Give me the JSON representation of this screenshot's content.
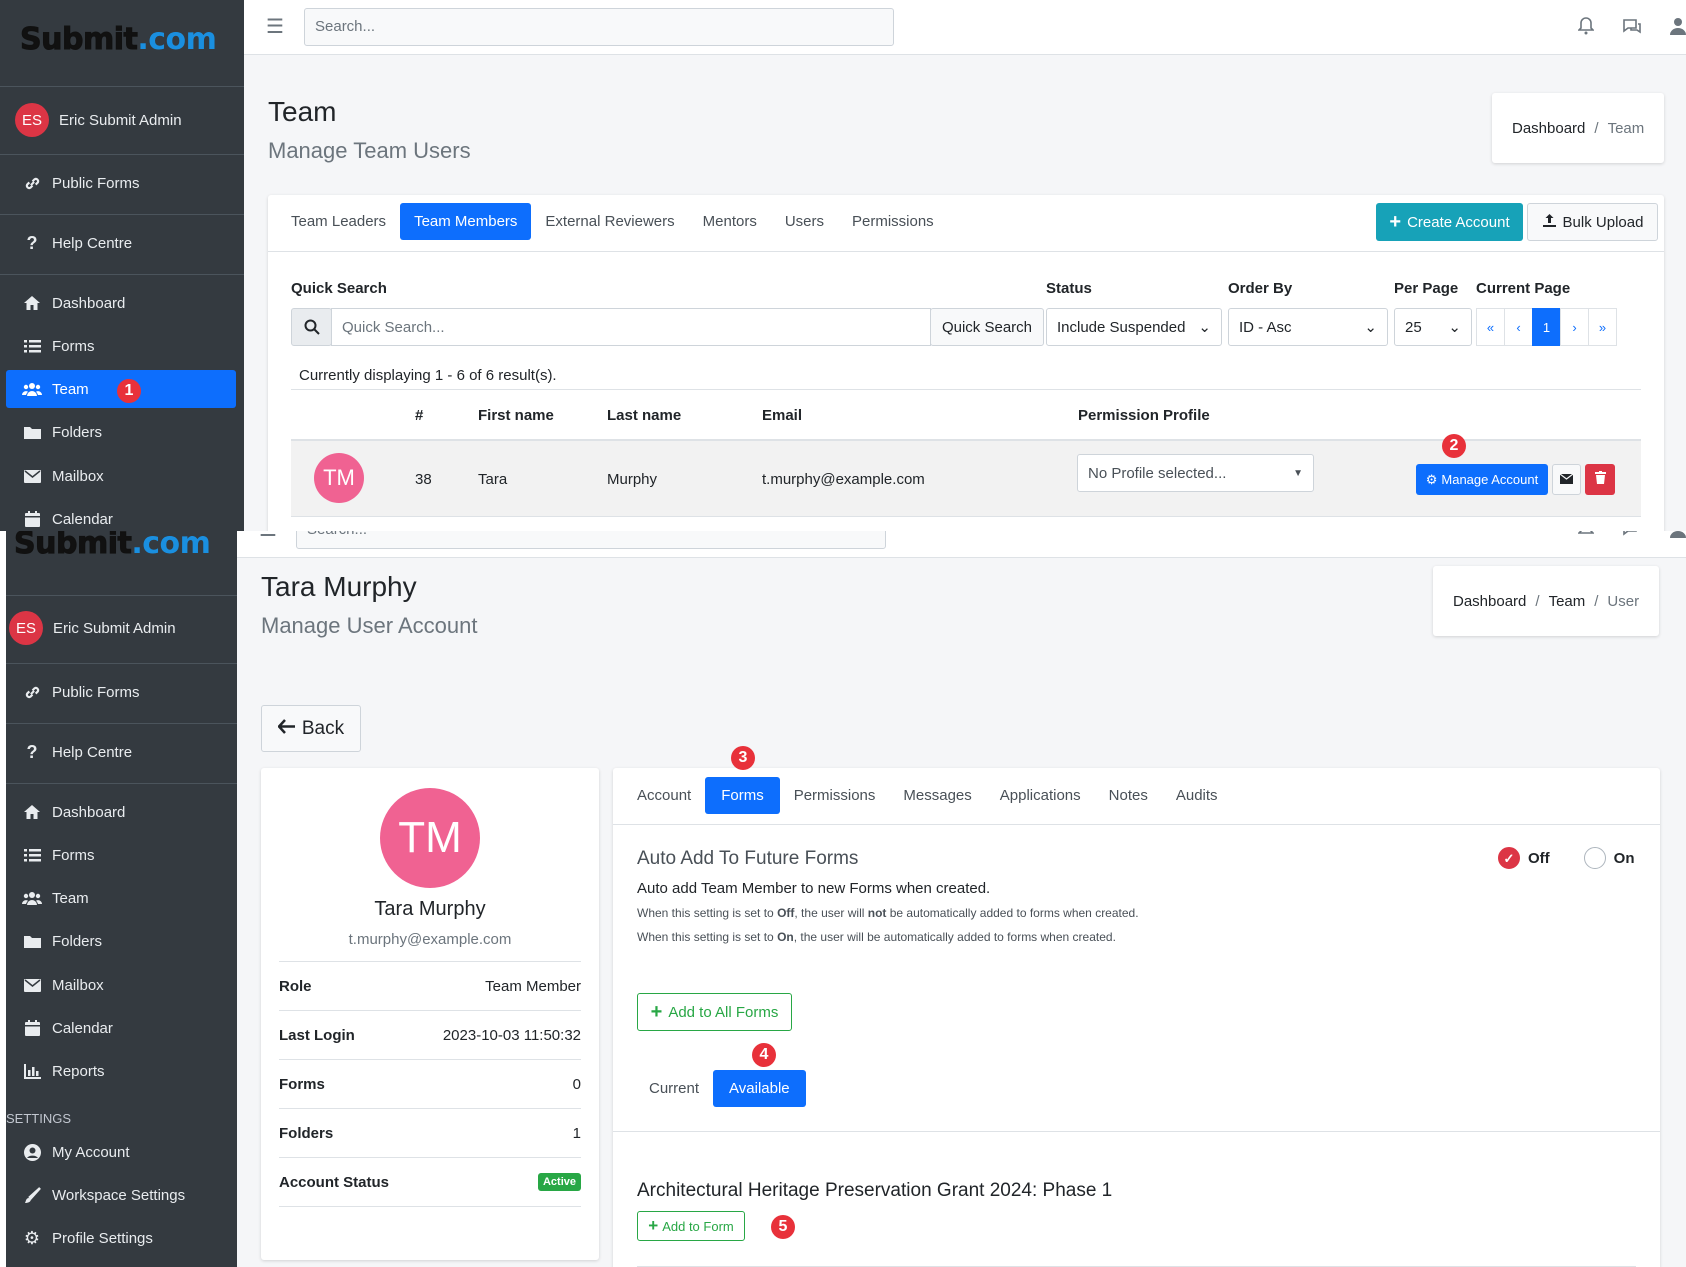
{
  "brand": {
    "part1": "Submit",
    "part2": ".com"
  },
  "topbar": {
    "search_placeholder": "Search..."
  },
  "user": {
    "initials": "ES",
    "name": "Eric Submit Admin"
  },
  "sidebar": {
    "items": [
      {
        "label": "Public Forms",
        "icon": "link-icon"
      },
      {
        "label": "Help Centre",
        "icon": "question-icon"
      },
      {
        "label": "Dashboard",
        "icon": "home-icon"
      },
      {
        "label": "Forms",
        "icon": "list-icon"
      },
      {
        "label": "Team",
        "icon": "users-icon"
      },
      {
        "label": "Folders",
        "icon": "folder-icon"
      },
      {
        "label": "Mailbox",
        "icon": "envelope-icon"
      },
      {
        "label": "Calendar",
        "icon": "calendar-icon"
      },
      {
        "label": "Reports",
        "icon": "chart-icon"
      }
    ],
    "settings_heading": "SETTINGS",
    "settings_items": [
      {
        "label": "My Account",
        "icon": "user-circle-icon"
      },
      {
        "label": "Workspace Settings",
        "icon": "brush-icon"
      },
      {
        "label": "Profile Settings",
        "icon": "gear-icon"
      }
    ]
  },
  "team_page": {
    "title": "Team",
    "subtitle": "Manage Team Users",
    "breadcrumb": [
      "Dashboard",
      "Team"
    ],
    "tabs": [
      "Team Leaders",
      "Team Members",
      "External Reviewers",
      "Mentors",
      "Users",
      "Permissions"
    ],
    "active_tab": "Team Members",
    "create_account": "Create Account",
    "bulk_upload": "Bulk Upload",
    "filters": {
      "quick_search_label": "Quick Search",
      "quick_search_placeholder": "Quick Search...",
      "quick_search_button": "Quick Search",
      "status_label": "Status",
      "status_value": "Include Suspended",
      "order_label": "Order By",
      "order_value": "ID - Asc",
      "per_page_label": "Per Page",
      "per_page_value": "25",
      "current_page_label": "Current Page",
      "pager": [
        "«",
        "‹",
        "1",
        "›",
        "»"
      ]
    },
    "result_text": "Currently displaying 1 - 6 of 6 result(s).",
    "columns": [
      "#",
      "First name",
      "Last name",
      "Email",
      "Permission Profile"
    ],
    "row": {
      "initials": "TM",
      "id": "38",
      "first": "Tara",
      "last": "Murphy",
      "email": "t.murphy@example.com",
      "profile": "No Profile selected...",
      "manage": "Manage Account"
    }
  },
  "user_page": {
    "title": "Tara Murphy",
    "subtitle": "Manage User Account",
    "breadcrumb": [
      "Dashboard",
      "Team",
      "User"
    ],
    "back": "Back",
    "profile": {
      "initials": "TM",
      "name": "Tara Murphy",
      "email": "t.murphy@example.com",
      "rows": [
        {
          "k": "Role",
          "v": "Team Member"
        },
        {
          "k": "Last Login",
          "v": "2023-10-03 11:50:32"
        },
        {
          "k": "Forms",
          "v": "0"
        },
        {
          "k": "Folders",
          "v": "1"
        },
        {
          "k": "Account Status",
          "v": "Active"
        }
      ]
    },
    "tabs": [
      "Account",
      "Forms",
      "Permissions",
      "Messages",
      "Applications",
      "Notes",
      "Audits"
    ],
    "active_tab": "Forms",
    "auto_add": {
      "title": "Auto Add To Future Forms",
      "off": "Off",
      "on": "On",
      "desc": "Auto add Team Member to new Forms when created.",
      "note_off_a": "When this setting is set to ",
      "note_off_b": "Off",
      "note_off_c": ", the user will ",
      "note_off_d": "not",
      "note_off_e": " be automatically added to forms when created.",
      "note_on_a": "When this setting is set to ",
      "note_on_b": "On",
      "note_on_c": ", the user will be automatically added to forms when created."
    },
    "add_all": "Add to All Forms",
    "sub_tabs": [
      "Current",
      "Available"
    ],
    "form_title": "Architectural Heritage Preservation Grant 2024: Phase 1",
    "add_to_form": "Add to Form"
  },
  "annotations": [
    "1",
    "2",
    "3",
    "4",
    "5"
  ],
  "colors": {
    "sidebar": "#343a40",
    "primary": "#0d6efd",
    "teal": "#17a2b8",
    "danger": "#dc3545",
    "success": "#28a745",
    "marker": "#e8313a"
  }
}
